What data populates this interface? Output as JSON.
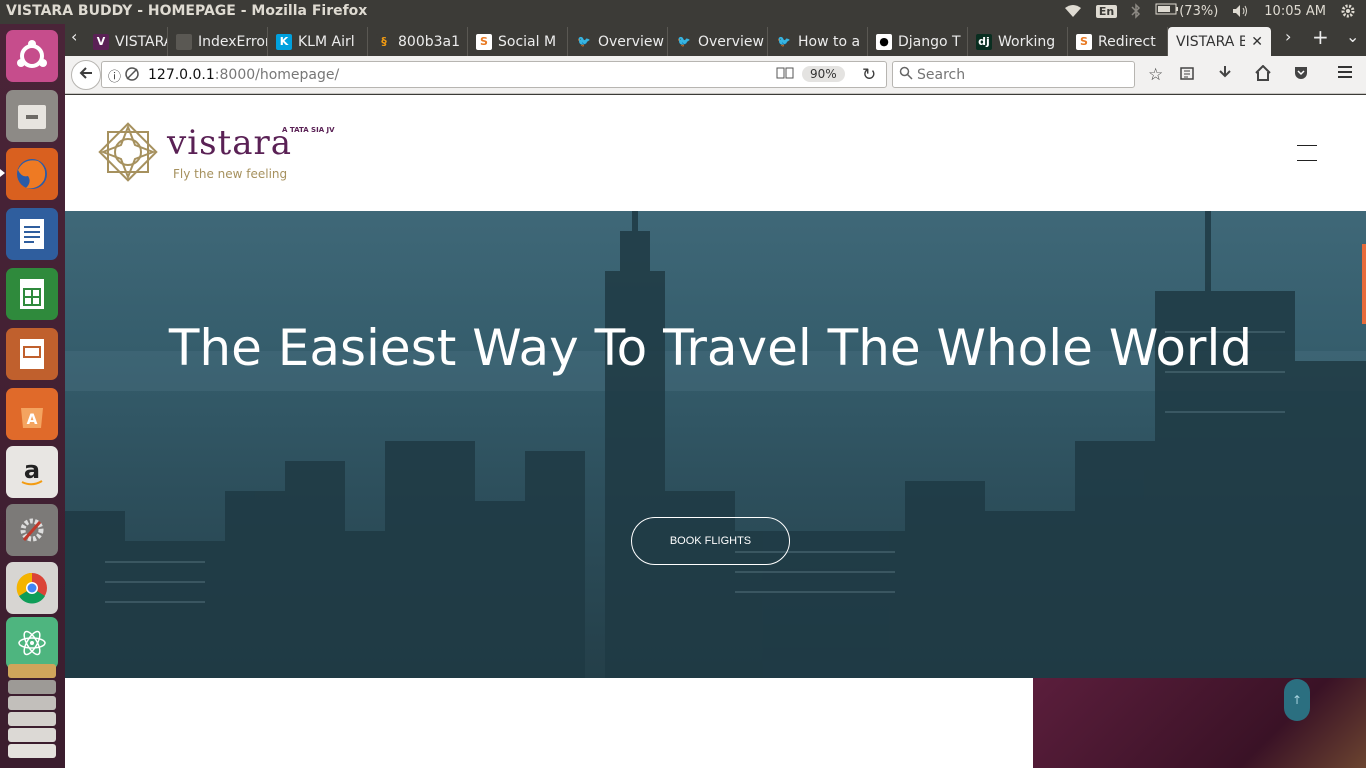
{
  "panel": {
    "window_title": "VISTARA BUDDY - HOMEPAGE - Mozilla Firefox",
    "keyboard": "En",
    "battery": "(73%)",
    "clock": "10:05 AM"
  },
  "launcher": {
    "items": [
      "ubuntu-dash",
      "files",
      "firefox",
      "libreoffice-writer",
      "libreoffice-calc",
      "libreoffice-impress",
      "software-center",
      "amazon",
      "system-settings",
      "chrome",
      "atom",
      "workspaces"
    ]
  },
  "tabs": [
    {
      "label": "VISTARA BU",
      "icon": "vistara-favicon"
    },
    {
      "label": "IndexError",
      "icon": "doc-favicon"
    },
    {
      "label": "KLM Airl",
      "icon": "klm-favicon"
    },
    {
      "label": "800b3a1",
      "icon": "sublime-favicon"
    },
    {
      "label": "Social M",
      "icon": "stackoverflow-favicon"
    },
    {
      "label": "Overview",
      "icon": "twitter-favicon"
    },
    {
      "label": "Overview",
      "icon": "twitter-favicon"
    },
    {
      "label": "How to a",
      "icon": "twitter-favicon"
    },
    {
      "label": "Django T",
      "icon": "github-favicon"
    },
    {
      "label": "Working",
      "icon": "django-favicon"
    },
    {
      "label": "Redirect",
      "icon": "stackoverflow-favicon"
    },
    {
      "label": "VISTARA B",
      "icon": "none",
      "active": true
    }
  ],
  "navbar": {
    "url_host": "127.0.0.1",
    "url_rest": ":8000/homepage/",
    "zoom": "90%",
    "search_placeholder": "Search"
  },
  "site": {
    "brand": "vistara",
    "jv": "A TATA SIA JV",
    "tagline": "Fly the new feeling",
    "hero_title": "The Easiest Way To Travel The Whole World",
    "hero_button": "BOOK FLIGHTS"
  },
  "colors": {
    "brand_purple": "#5a2155",
    "brand_gold": "#a6915e",
    "hero_overlay": "#355d6c"
  }
}
